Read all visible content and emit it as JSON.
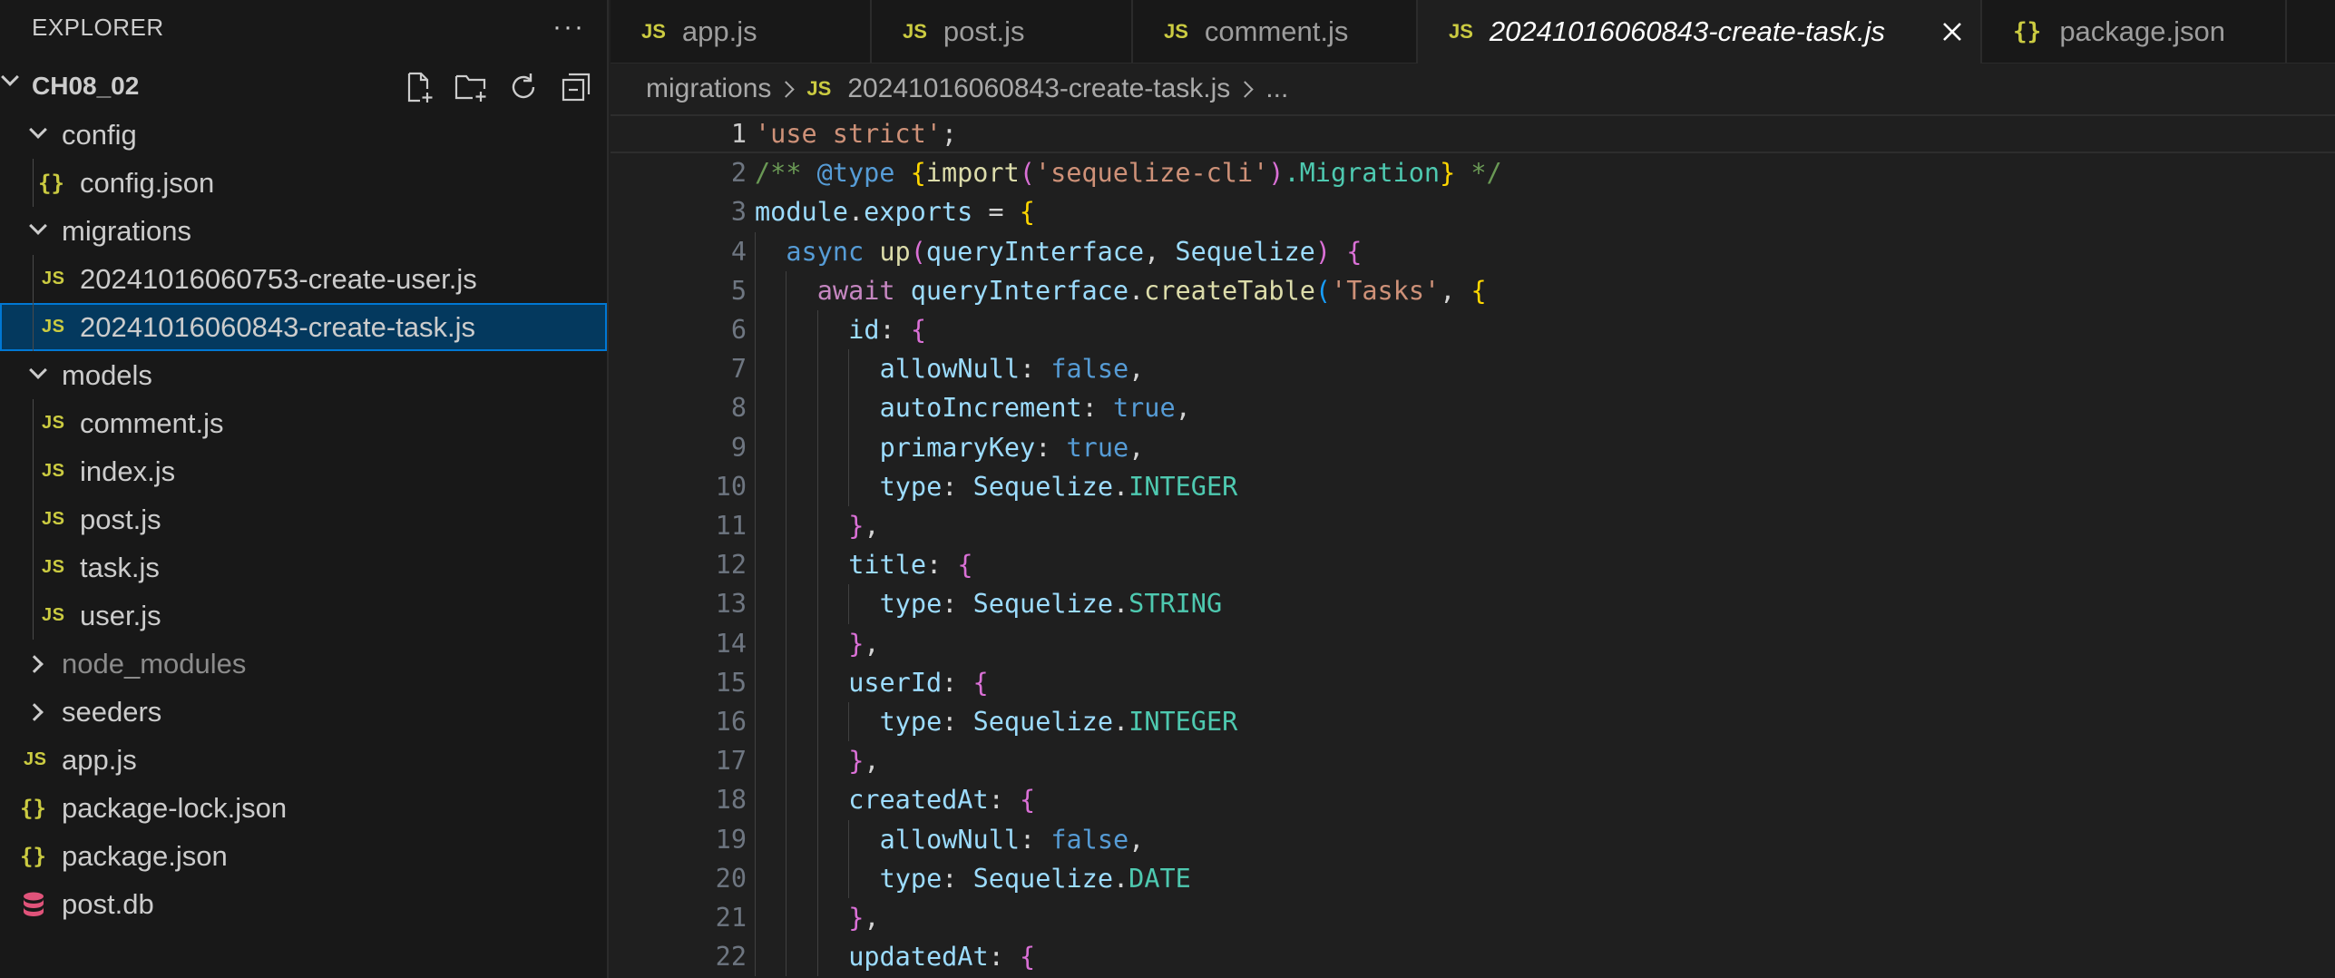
{
  "explorer": {
    "title": "EXPLORER",
    "more": "···",
    "project": "CH08_02",
    "actions": [
      "new-file-icon",
      "new-folder-icon",
      "refresh-icon",
      "collapse-all-icon"
    ],
    "tree": [
      {
        "label": "config",
        "kind": "folder-open",
        "depth": 1
      },
      {
        "label": "config.json",
        "kind": "json",
        "depth": 2
      },
      {
        "label": "migrations",
        "kind": "folder-open",
        "depth": 1
      },
      {
        "label": "20241016060753-create-user.js",
        "kind": "js",
        "depth": 2
      },
      {
        "label": "20241016060843-create-task.js",
        "kind": "js",
        "depth": 2,
        "selected": true
      },
      {
        "label": "models",
        "kind": "folder-open",
        "depth": 1
      },
      {
        "label": "comment.js",
        "kind": "js",
        "depth": 2
      },
      {
        "label": "index.js",
        "kind": "js",
        "depth": 2
      },
      {
        "label": "post.js",
        "kind": "js",
        "depth": 2
      },
      {
        "label": "task.js",
        "kind": "js",
        "depth": 2
      },
      {
        "label": "user.js",
        "kind": "js",
        "depth": 2
      },
      {
        "label": "node_modules",
        "kind": "folder-closed",
        "depth": 1,
        "dim": true
      },
      {
        "label": "seeders",
        "kind": "folder-closed",
        "depth": 1
      },
      {
        "label": "app.js",
        "kind": "js",
        "depth": 1
      },
      {
        "label": "package-lock.json",
        "kind": "json",
        "depth": 1
      },
      {
        "label": "package.json",
        "kind": "json",
        "depth": 1
      },
      {
        "label": "post.db",
        "kind": "db",
        "depth": 1
      }
    ],
    "js_badge": "JS",
    "json_badge": "{}"
  },
  "tabs": [
    {
      "label": "app.js",
      "kind": "js",
      "width": 288
    },
    {
      "label": "post.js",
      "kind": "js",
      "width": 288
    },
    {
      "label": "comment.js",
      "kind": "js",
      "width": 314
    },
    {
      "label": "20241016060843-create-task.js",
      "kind": "js",
      "active": true,
      "width": 622
    },
    {
      "label": "package.json",
      "kind": "json",
      "width": 336
    }
  ],
  "breadcrumb": {
    "folder": "migrations",
    "file": "20241016060843-create-task.js",
    "more": "..."
  },
  "editor": {
    "active_line": 1,
    "lines": [
      {
        "n": "1",
        "indent": 0,
        "tokens": [
          [
            "s",
            "'use strict'"
          ],
          [
            "p",
            ";"
          ]
        ]
      },
      {
        "n": "2",
        "indent": 0,
        "tokens": [
          [
            "c",
            "/** "
          ],
          [
            "ct",
            "@type"
          ],
          [
            "c",
            " "
          ],
          [
            "b1",
            "{"
          ],
          [
            "f",
            "import"
          ],
          [
            "b2",
            "("
          ],
          [
            "s",
            "'sequelize-cli'"
          ],
          [
            "b2",
            ")"
          ],
          [
            "t",
            ".Migration"
          ],
          [
            "b1",
            "}"
          ],
          [
            "c",
            " */"
          ]
        ]
      },
      {
        "n": "3",
        "indent": 0,
        "tokens": [
          [
            "v",
            "module"
          ],
          [
            "p",
            "."
          ],
          [
            "v",
            "exports"
          ],
          [
            "p",
            " = "
          ],
          [
            "b1",
            "{"
          ]
        ]
      },
      {
        "n": "4",
        "indent": 1,
        "tokens": [
          [
            "kw",
            "async"
          ],
          [
            "p",
            " "
          ],
          [
            "f",
            "up"
          ],
          [
            "b2",
            "("
          ],
          [
            "v",
            "queryInterface"
          ],
          [
            "p",
            ", "
          ],
          [
            "v",
            "Sequelize"
          ],
          [
            "b2",
            ")"
          ],
          [
            "p",
            " "
          ],
          [
            "b2",
            "{"
          ]
        ]
      },
      {
        "n": "5",
        "indent": 2,
        "tokens": [
          [
            "ctl",
            "await"
          ],
          [
            "p",
            " "
          ],
          [
            "v",
            "queryInterface"
          ],
          [
            "p",
            "."
          ],
          [
            "f",
            "createTable"
          ],
          [
            "b3",
            "("
          ],
          [
            "s",
            "'Tasks'"
          ],
          [
            "p",
            ", "
          ],
          [
            "b1",
            "{"
          ]
        ]
      },
      {
        "n": "6",
        "indent": 3,
        "tokens": [
          [
            "v",
            "id"
          ],
          [
            "p",
            ": "
          ],
          [
            "b2",
            "{"
          ]
        ]
      },
      {
        "n": "7",
        "indent": 4,
        "tokens": [
          [
            "v",
            "allowNull"
          ],
          [
            "p",
            ": "
          ],
          [
            "kw",
            "false"
          ],
          [
            "p",
            ","
          ]
        ]
      },
      {
        "n": "8",
        "indent": 4,
        "tokens": [
          [
            "v",
            "autoIncrement"
          ],
          [
            "p",
            ": "
          ],
          [
            "kw",
            "true"
          ],
          [
            "p",
            ","
          ]
        ]
      },
      {
        "n": "9",
        "indent": 4,
        "tokens": [
          [
            "v",
            "primaryKey"
          ],
          [
            "p",
            ": "
          ],
          [
            "kw",
            "true"
          ],
          [
            "p",
            ","
          ]
        ]
      },
      {
        "n": "10",
        "indent": 4,
        "tokens": [
          [
            "v",
            "type"
          ],
          [
            "p",
            ": "
          ],
          [
            "v",
            "Sequelize"
          ],
          [
            "p",
            "."
          ],
          [
            "t",
            "INTEGER"
          ]
        ]
      },
      {
        "n": "11",
        "indent": 3,
        "tokens": [
          [
            "b2",
            "}"
          ],
          [
            "p",
            ","
          ]
        ]
      },
      {
        "n": "12",
        "indent": 3,
        "tokens": [
          [
            "v",
            "title"
          ],
          [
            "p",
            ": "
          ],
          [
            "b2",
            "{"
          ]
        ]
      },
      {
        "n": "13",
        "indent": 4,
        "tokens": [
          [
            "v",
            "type"
          ],
          [
            "p",
            ": "
          ],
          [
            "v",
            "Sequelize"
          ],
          [
            "p",
            "."
          ],
          [
            "t",
            "STRING"
          ]
        ]
      },
      {
        "n": "14",
        "indent": 3,
        "tokens": [
          [
            "b2",
            "}"
          ],
          [
            "p",
            ","
          ]
        ]
      },
      {
        "n": "15",
        "indent": 3,
        "tokens": [
          [
            "v",
            "userId"
          ],
          [
            "p",
            ": "
          ],
          [
            "b2",
            "{"
          ]
        ]
      },
      {
        "n": "16",
        "indent": 4,
        "tokens": [
          [
            "v",
            "type"
          ],
          [
            "p",
            ": "
          ],
          [
            "v",
            "Sequelize"
          ],
          [
            "p",
            "."
          ],
          [
            "t",
            "INTEGER"
          ]
        ]
      },
      {
        "n": "17",
        "indent": 3,
        "tokens": [
          [
            "b2",
            "}"
          ],
          [
            "p",
            ","
          ]
        ]
      },
      {
        "n": "18",
        "indent": 3,
        "tokens": [
          [
            "v",
            "createdAt"
          ],
          [
            "p",
            ": "
          ],
          [
            "b2",
            "{"
          ]
        ]
      },
      {
        "n": "19",
        "indent": 4,
        "tokens": [
          [
            "v",
            "allowNull"
          ],
          [
            "p",
            ": "
          ],
          [
            "kw",
            "false"
          ],
          [
            "p",
            ","
          ]
        ]
      },
      {
        "n": "20",
        "indent": 4,
        "tokens": [
          [
            "v",
            "type"
          ],
          [
            "p",
            ": "
          ],
          [
            "v",
            "Sequelize"
          ],
          [
            "p",
            "."
          ],
          [
            "t",
            "DATE"
          ]
        ]
      },
      {
        "n": "21",
        "indent": 3,
        "tokens": [
          [
            "b2",
            "}"
          ],
          [
            "p",
            ","
          ]
        ]
      },
      {
        "n": "22",
        "indent": 3,
        "tokens": [
          [
            "v",
            "updatedAt"
          ],
          [
            "p",
            ": "
          ],
          [
            "b2",
            "{"
          ]
        ]
      }
    ]
  },
  "colors": {
    "sidebar_bg": "#181818",
    "editor_bg": "#1f1f1f",
    "selection": "#04395e",
    "focus_border": "#0078d4",
    "js_yellow": "#cbcb41",
    "db_pink": "#e0537a"
  }
}
